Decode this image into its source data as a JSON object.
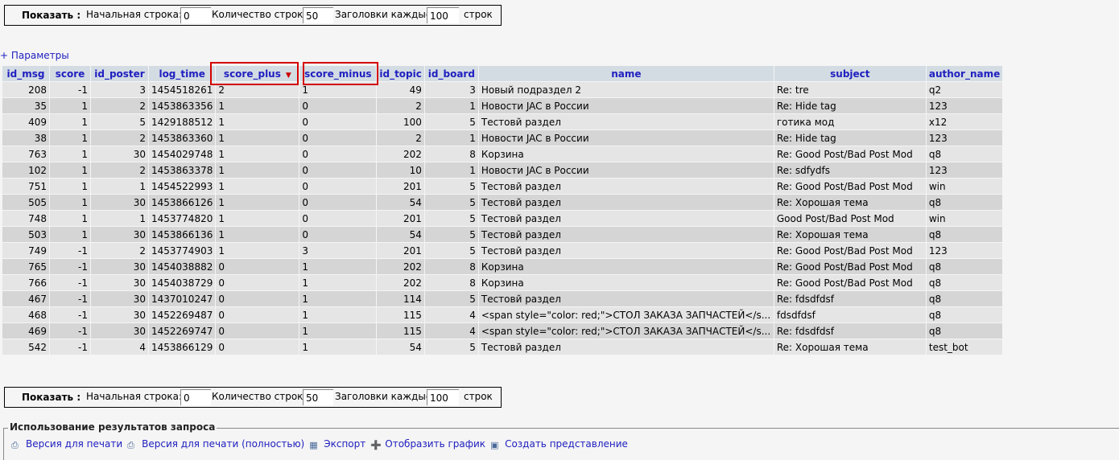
{
  "nav": {
    "show_button": "Показать :",
    "start_row_label": "Начальная строка:",
    "start_row_value": "0",
    "row_count_label": "Количество строк:",
    "row_count_value": "50",
    "headers_every_label": "Заголовки каждые",
    "headers_every_value": "100",
    "headers_every_suffix": "строк"
  },
  "params_link": "+ Параметры",
  "table": {
    "columns": [
      "id_msg",
      "score",
      "id_poster",
      "log_time",
      "score_plus",
      "score_minus",
      "id_topic",
      "id_board",
      "name",
      "subject",
      "author_name"
    ],
    "sorted_column": "score_plus",
    "rows": [
      [
        "208",
        "-1",
        "3",
        "1454518261",
        "2",
        "1",
        "49",
        "3",
        "Новый подраздел 2",
        "Re: tre",
        "q2"
      ],
      [
        "35",
        "1",
        "2",
        "1453863356",
        "1",
        "0",
        "2",
        "1",
        "Новости JAC в России",
        "Re: Hide tag",
        "123"
      ],
      [
        "409",
        "1",
        "5",
        "1429188512",
        "1",
        "0",
        "100",
        "5",
        "Тестовй раздел",
        "готика мод",
        "x12"
      ],
      [
        "38",
        "1",
        "2",
        "1453863360",
        "1",
        "0",
        "2",
        "1",
        "Новости JAC в России",
        "Re: Hide tag",
        "123"
      ],
      [
        "763",
        "1",
        "30",
        "1454029748",
        "1",
        "0",
        "202",
        "8",
        "Корзина",
        "Re: Good Post/Bad Post Mod",
        "q8"
      ],
      [
        "102",
        "1",
        "2",
        "1453863378",
        "1",
        "0",
        "10",
        "1",
        "Новости JAC в России",
        "Re: sdfydfs",
        "123"
      ],
      [
        "751",
        "1",
        "1",
        "1454522993",
        "1",
        "0",
        "201",
        "5",
        "Тестовй раздел",
        "Re: Good Post/Bad Post Mod",
        "win"
      ],
      [
        "505",
        "1",
        "30",
        "1453866126",
        "1",
        "0",
        "54",
        "5",
        "Тестовй раздел",
        "Re: Хорошая тема",
        "q8"
      ],
      [
        "748",
        "1",
        "1",
        "1453774820",
        "1",
        "0",
        "201",
        "5",
        "Тестовй раздел",
        "Good Post/Bad Post Mod",
        "win"
      ],
      [
        "503",
        "1",
        "30",
        "1453866136",
        "1",
        "0",
        "54",
        "5",
        "Тестовй раздел",
        "Re: Хорошая тема",
        "q8"
      ],
      [
        "749",
        "-1",
        "2",
        "1453774903",
        "1",
        "3",
        "201",
        "5",
        "Тестовй раздел",
        "Re: Good Post/Bad Post Mod",
        "123"
      ],
      [
        "765",
        "-1",
        "30",
        "1454038882",
        "0",
        "1",
        "202",
        "8",
        "Корзина",
        "Re: Good Post/Bad Post Mod",
        "q8"
      ],
      [
        "766",
        "-1",
        "30",
        "1454038729",
        "0",
        "1",
        "202",
        "8",
        "Корзина",
        "Re: Good Post/Bad Post Mod",
        "q8"
      ],
      [
        "467",
        "-1",
        "30",
        "1437010247",
        "0",
        "1",
        "114",
        "5",
        "Тестовй раздел",
        "Re: fdsdfdsf",
        "q8"
      ],
      [
        "468",
        "-1",
        "30",
        "1452269487",
        "0",
        "1",
        "115",
        "4",
        "<span style=\"color: red;\">СТОЛ ЗАКАЗА ЗАПЧАСТЕЙ</s...",
        "fdsdfdsf",
        "q8"
      ],
      [
        "469",
        "-1",
        "30",
        "1452269747",
        "0",
        "1",
        "115",
        "4",
        "<span style=\"color: red;\">СТОЛ ЗАКАЗА ЗАПЧАСТЕЙ</s...",
        "Re: fdsdfdsf",
        "q8"
      ],
      [
        "542",
        "-1",
        "4",
        "1453866129",
        "0",
        "1",
        "54",
        "5",
        "Тестовй раздел",
        "Re: Хорошая тема",
        "test_bot"
      ]
    ]
  },
  "usage": {
    "legend": "Использование результатов запроса",
    "links": [
      {
        "label": "Версия для печати",
        "icon": "print-icon"
      },
      {
        "label": "Версия для печати (полностью)",
        "icon": "print-full-icon"
      },
      {
        "label": "Экспорт",
        "icon": "export-icon"
      },
      {
        "label": "Отобразить график",
        "icon": "chart-icon"
      },
      {
        "label": "Создать представление",
        "icon": "view-icon"
      }
    ]
  }
}
